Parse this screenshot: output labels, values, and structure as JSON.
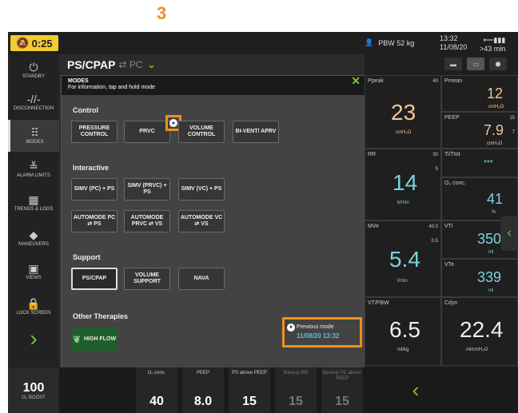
{
  "step": "3",
  "topbar": {
    "alarm_time": "0:25",
    "pbw": "PBW 52 kg",
    "time": "13:32",
    "date": "11/08/20",
    "battery": ">43 min",
    "battery_top": "III"
  },
  "sidebar": {
    "items": [
      {
        "label": "STANDBY",
        "icon": "power-icon",
        "glyph": "⏻"
      },
      {
        "label": "DISCONNECTION",
        "icon": "disconnect-icon",
        "glyph": "-//-"
      },
      {
        "label": "MODES",
        "icon": "modes-icon",
        "glyph": "⠿"
      },
      {
        "label": "ALARM LIMITS",
        "icon": "alarm-limits-icon",
        "glyph": "≚"
      },
      {
        "label": "TRENDS & LOGS",
        "icon": "trends-icon",
        "glyph": "▦"
      },
      {
        "label": "MANEUVERS",
        "icon": "maneuvers-icon",
        "glyph": "◆"
      },
      {
        "label": "VIEWS",
        "icon": "views-icon",
        "glyph": "▣"
      },
      {
        "label": "LOCK SCREEN",
        "icon": "lock-icon",
        "glyph": "🔒"
      }
    ],
    "arrow": "›"
  },
  "mode_header": {
    "mode": "PS/CPAP",
    "sub": "⇄ PC",
    "chevron": "⌄"
  },
  "dialog": {
    "title": "MODES",
    "subtitle": "For information, tap and hold mode",
    "close": "✕",
    "sections": {
      "control": "Control",
      "interactive": "Interactive",
      "support": "Support",
      "other": "Other Therapies"
    },
    "control": [
      "PRESSURE CONTROL",
      "PRVC",
      "VOLUME CONTROL",
      "BI-VENT/ APRV"
    ],
    "interactive_row1": [
      "SIMV (PC) + PS",
      "SIMV (PRVC) + PS",
      "SIMV (VC) + PS"
    ],
    "interactive_row2": [
      "AUTOMODE PC ⇄ PS",
      "AUTOMODE PRVC ⇄ VS",
      "AUTOMODE VC ⇄ VS"
    ],
    "support": [
      "PS/CPAP",
      "VOLUME SUPPORT",
      "NAVA"
    ],
    "high_flow": "HIGH FLOW",
    "previous_mode_label": "Previous mode",
    "previous_mode_time": "11/08/20 13:32",
    "info_glyph": "●"
  },
  "right_panel": {
    "ppeak": {
      "label": "Ppeak",
      "limit": "40",
      "value": "23",
      "unit": "cmH₂O"
    },
    "pmean": {
      "label": "Pmean",
      "value": "12",
      "unit": "cmH₂O"
    },
    "peep": {
      "label": "PEEP",
      "limit_hi": "15",
      "limit_lo": "7",
      "value": "7.9",
      "unit": "cmH₂O"
    },
    "rr": {
      "label": "RR",
      "limit_hi": "30",
      "limit_lo": "5",
      "value": "14",
      "unit": "b/min"
    },
    "ti_ttot": {
      "label": "Ti/Ttot",
      "value": "***"
    },
    "o2": {
      "label": "O₂ conc.",
      "value": "41",
      "unit": "%"
    },
    "mve": {
      "label": "MVe",
      "limit_hi": "40.0",
      "limit_lo": "0.5",
      "value": "5.4",
      "unit": "l/min"
    },
    "vti": {
      "label": "VTi",
      "value": "350",
      "unit": "ml"
    },
    "vte": {
      "label": "VTe",
      "value": "339",
      "unit": "ml"
    },
    "vt_pbw": {
      "label": "VT/PBW",
      "value": "6.5",
      "unit": "ml/kg"
    },
    "cdyn": {
      "label": "Cdyn",
      "value": "22.4",
      "unit": "ml/cmH₂O"
    }
  },
  "bottom": {
    "o2_boost": {
      "value": "100",
      "label": "O₂ BOOST"
    },
    "settings": [
      {
        "label": "O₂ conc.",
        "value": "40"
      },
      {
        "label": "PEEP",
        "value": "8.0"
      },
      {
        "label": "PS above PEEP",
        "value": "15"
      },
      {
        "label": "Backup RR",
        "value": "15"
      },
      {
        "label": "Backup PC above PEEP",
        "value": "15"
      }
    ],
    "arrow": "‹"
  },
  "side_tab": "‹"
}
